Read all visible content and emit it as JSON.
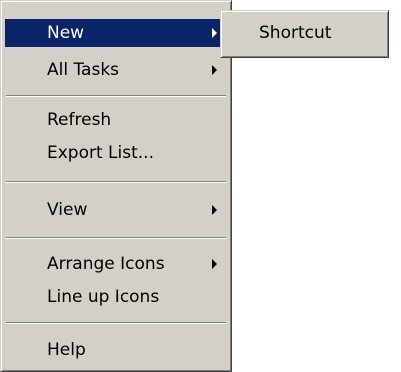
{
  "context_menu": {
    "items": [
      {
        "label": "New",
        "submenu": true,
        "highlighted": true
      },
      {
        "label": "All Tasks",
        "submenu": true
      },
      {
        "label": "Refresh",
        "submenu": false
      },
      {
        "label": "Export List...",
        "submenu": false
      },
      {
        "label": "View",
        "submenu": true
      },
      {
        "label": "Arrange Icons",
        "submenu": true
      },
      {
        "label": "Line up Icons",
        "submenu": false
      },
      {
        "label": "Help",
        "submenu": false
      }
    ]
  },
  "submenu": {
    "items": [
      {
        "label": "Shortcut"
      }
    ]
  },
  "colors": {
    "menu_face": "#d4d0c8",
    "highlight": "#0a246a",
    "highlight_text": "#ffffff"
  }
}
